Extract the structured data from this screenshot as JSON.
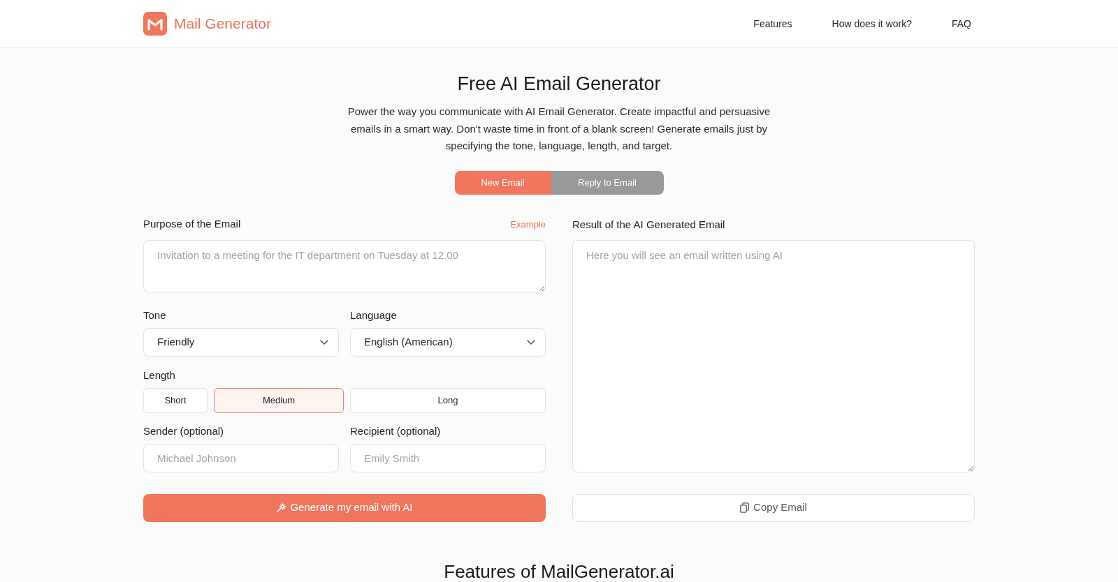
{
  "header": {
    "logo_text": "Mail Generator",
    "nav": [
      "Features",
      "How does it work?",
      "FAQ"
    ]
  },
  "hero": {
    "title": "Free AI Email Generator",
    "description": "Power the way you communicate with AI Email Generator. Create impactful and persuasive emails in a smart way. Don't waste time in front of a blank screen! Generate emails just by specifying the tone, language, length, and target."
  },
  "mode_tabs": [
    {
      "label": "New Email",
      "selected": true
    },
    {
      "label": "Reply to Email",
      "selected": false
    }
  ],
  "form": {
    "purpose": {
      "label": "Purpose of the Email",
      "example_link": "Example",
      "placeholder": "Invitation to a meeting for the IT department on Tuesday at 12.00"
    },
    "tone": {
      "label": "Tone",
      "value": "Friendly"
    },
    "language": {
      "label": "Language",
      "value": "English (American)"
    },
    "length": {
      "label": "Length",
      "options": [
        {
          "label": "Short",
          "selected": false
        },
        {
          "label": "Medium",
          "selected": true
        },
        {
          "label": "Long",
          "selected": false
        }
      ]
    },
    "sender": {
      "label": "Sender (optional)",
      "placeholder": "Michael Johnson"
    },
    "recipient": {
      "label": "Recipient (optional)",
      "placeholder": "Emily Smith"
    },
    "generate_button": "Generate my email with AI"
  },
  "result": {
    "label": "Result of the AI Generated Email",
    "placeholder": "Here you will see an email written using AI",
    "copy_button": "Copy Email"
  },
  "features_heading": "Features of MailGenerator.ai"
}
